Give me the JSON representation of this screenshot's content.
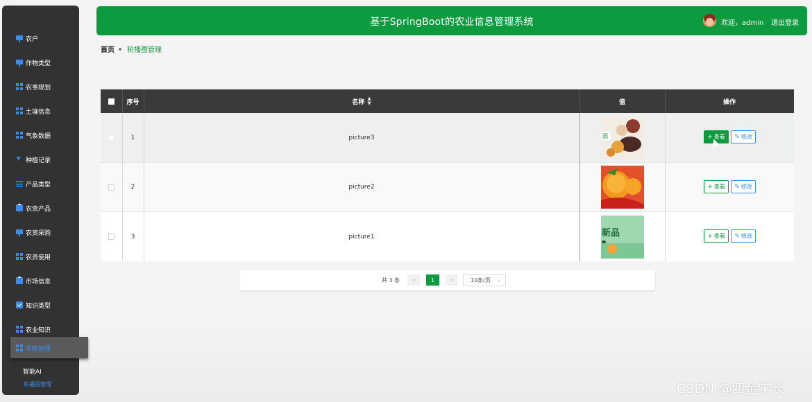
{
  "app": {
    "title": "基于SpringBoot的农业信息管理系统",
    "welcome": "欢迎，admin",
    "logout": "退出登录"
  },
  "sidebar": {
    "items": [
      {
        "label": "农户",
        "icon": "monitor-icon"
      },
      {
        "label": "作物类型",
        "icon": "monitor-icon"
      },
      {
        "label": "农事规划",
        "icon": "grid-icon"
      },
      {
        "label": "土壤信息",
        "icon": "grid-icon"
      },
      {
        "label": "气象数据",
        "icon": "grid-icon"
      },
      {
        "label": "种植记录",
        "icon": "send-icon"
      },
      {
        "label": "产品类型",
        "icon": "sliders-icon"
      },
      {
        "label": "农资产品",
        "icon": "clipboard-icon"
      },
      {
        "label": "农资采购",
        "icon": "monitor-icon"
      },
      {
        "label": "农资使用",
        "icon": "grid-icon"
      },
      {
        "label": "市场信息",
        "icon": "clipboard-icon"
      },
      {
        "label": "知识类型",
        "icon": "check-icon"
      },
      {
        "label": "农业知识",
        "icon": "grid-icon"
      }
    ],
    "active": {
      "label": "系统管理",
      "icon": "grid-icon"
    },
    "sub_items": [
      {
        "label": "智能AI"
      },
      {
        "label": "轮播图管理"
      }
    ],
    "accent_color": "#3a8df0"
  },
  "breadcrumb": {
    "home": "首页",
    "current": "轮播图管理"
  },
  "table": {
    "headers": {
      "index": "序号",
      "name": "名称",
      "value": "值",
      "actions": "操作"
    },
    "rows": [
      {
        "index": "1",
        "name": "picture3",
        "image": "food-collage"
      },
      {
        "index": "2",
        "name": "picture2",
        "image": "orange-chili"
      },
      {
        "index": "3",
        "name": "picture1",
        "image": "new-product-banner",
        "image_text": "新品"
      }
    ],
    "view_label": "查看",
    "edit_label": "修改"
  },
  "pagination": {
    "total": "共 3 条",
    "prev": "<",
    "current_page": "1",
    "next": ">",
    "page_size": "10条/页"
  },
  "watermark": "CSDN @四金学长",
  "colors": {
    "primary_green": "#0e9a3e",
    "header_dark": "#3a3a3a",
    "sidebar_bg": "#323232"
  }
}
